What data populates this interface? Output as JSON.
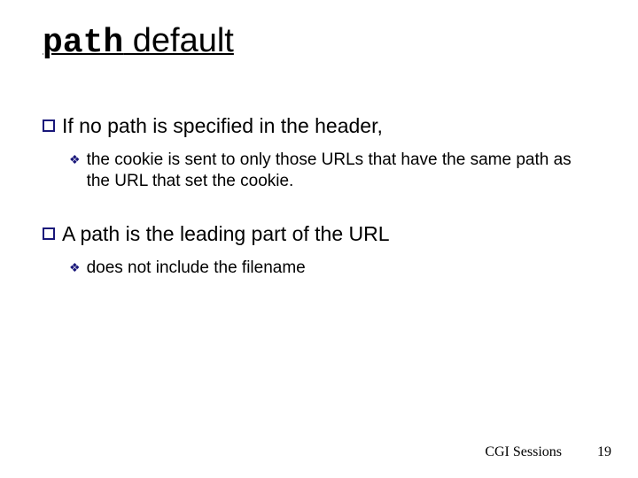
{
  "title": {
    "mono_part": "path",
    "plain_part": " default"
  },
  "bullets": [
    {
      "text": "If no path is specified in the header,",
      "sub": [
        "the cookie is sent to only those URLs that have the same path as the URL that set the cookie."
      ]
    },
    {
      "text": "A path is the leading part of the URL",
      "sub": [
        "does not include the filename"
      ]
    }
  ],
  "footer": {
    "label": "CGI Sessions",
    "page": "19"
  }
}
